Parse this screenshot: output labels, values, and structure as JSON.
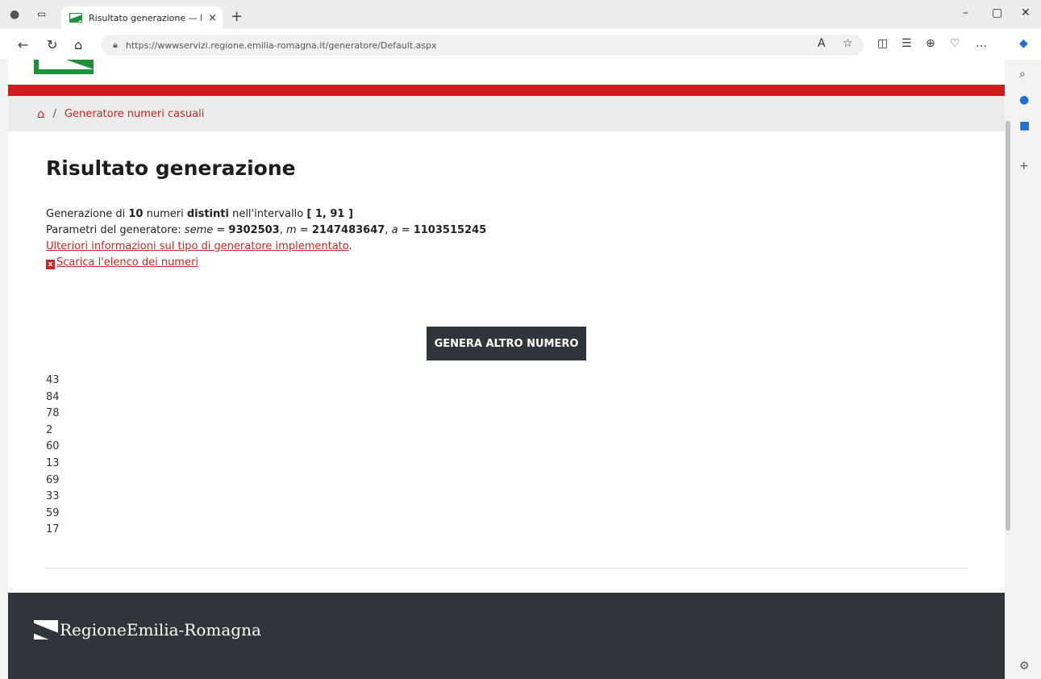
{
  "browser": {
    "tab_title": "Risultato generazione — E-R Il p",
    "tab_close": "×",
    "new_tab": "+",
    "url": "https://wwwservizi.regione.emilia-romagna.it/generatore/Default.aspx",
    "minimize": "–",
    "maximize": "▢",
    "close": "✕"
  },
  "breadcrumb": {
    "separator": "/",
    "current": "Generatore numeri casuali"
  },
  "page_title": "Risultato generazione",
  "info": {
    "line1_prefix": "Generazione di ",
    "count": "10",
    "line1_mid": " numeri ",
    "distinct": "distinti",
    "line1_suffix": " nell'intervallo ",
    "interval": "[ 1, 91 ]",
    "line2_prefix": "Parametri del generatore: ",
    "seed_label": "seme",
    "eq": " = ",
    "seed": "9302503",
    "comma": ", ",
    "m_label": "m",
    "m_value": "2147483647",
    "a_label": "a",
    "a_value": "1103515245",
    "more_link": "Ulteriori informazioni sul tipo di generatore implementato",
    "period": ".",
    "download_link": "Scarica l'elenco dei numeri"
  },
  "generate_button": "GENERA ALTRO NUMERO",
  "numbers": [
    "43",
    "84",
    "78",
    "2",
    "60",
    "13",
    "69",
    "33",
    "59",
    "17"
  ],
  "footer": {
    "logo_text": "RegioneEmilia-Romagna"
  },
  "colors": {
    "accent_red": "#cf1d1d",
    "link_red": "#c5291f",
    "dark": "#30353b"
  }
}
